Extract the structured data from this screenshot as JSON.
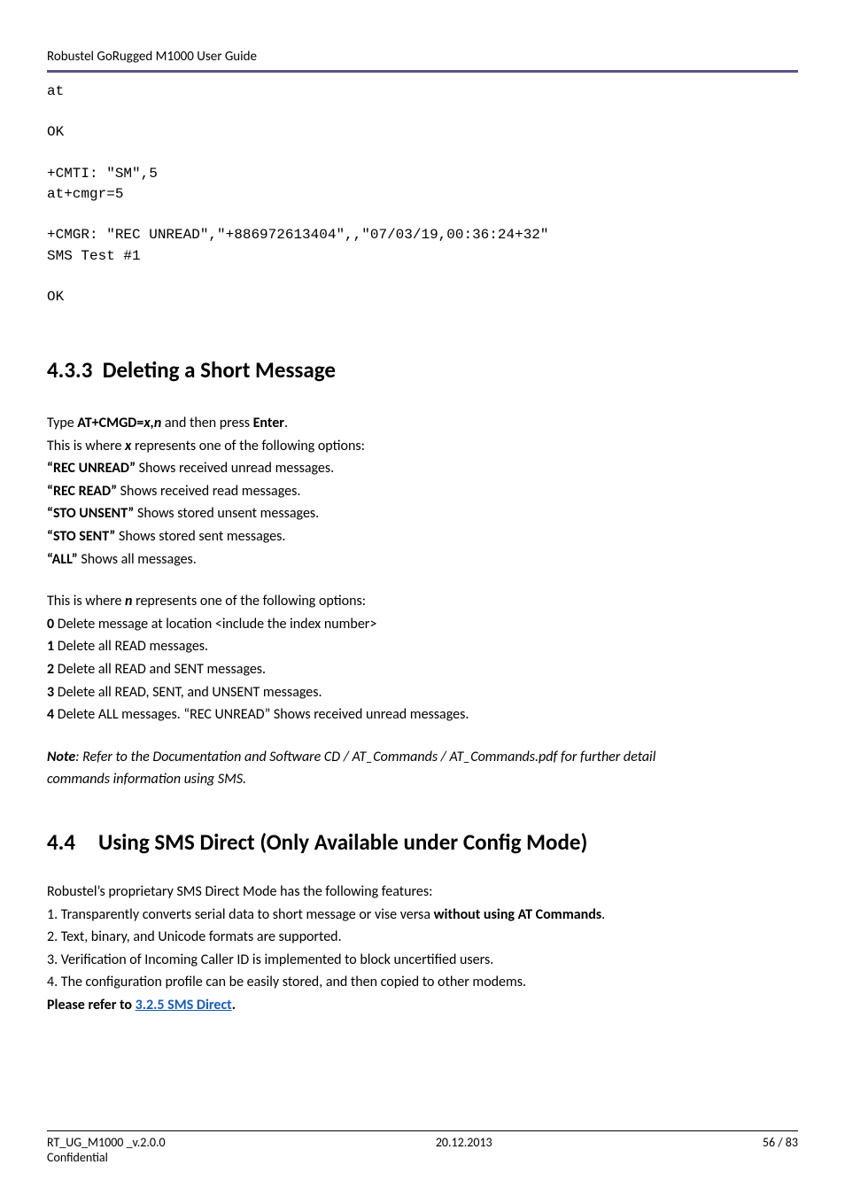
{
  "header": {
    "title": "Robustel GoRugged M1000 User Guide"
  },
  "terminal": {
    "text": "at\n\nOK\n\n+CMTI: \"SM\",5\nat+cmgr=5\n\n+CMGR: \"REC UNREAD\",\"+886972613404\",,\"07/03/19,00:36:24+32\"\nSMS Test #1\n\nOK"
  },
  "section_433": {
    "number": "4.3.3",
    "title": "Deleting a Short Message",
    "type_prefix": "Type ",
    "cmd": "AT+CMGD=",
    "cmd_var": "x,n",
    "type_suffix": " and then press ",
    "enter": "Enter",
    "period": ".",
    "x_intro_a": "This is where ",
    "x_intro_b": "x",
    "x_intro_c": " represents one of the following options:",
    "x_opts": [
      {
        "k": "“REC UNREAD”",
        "v": " Shows received unread messages."
      },
      {
        "k": "“REC READ”",
        "v": " Shows received read messages."
      },
      {
        "k": "“STO UNSENT”",
        "v": " Shows stored unsent messages."
      },
      {
        "k": "“STO SENT”",
        "v": " Shows stored sent messages."
      },
      {
        "k": "“ALL”",
        "v": " Shows all messages."
      }
    ],
    "n_intro_a": "This is where ",
    "n_intro_b": "n",
    "n_intro_c": " represents one of the following options:",
    "n_opts": [
      {
        "k": "0",
        "v": " Delete message at location <include the index number>"
      },
      {
        "k": "1",
        "v": " Delete all READ messages."
      },
      {
        "k": "2",
        "v": " Delete all READ and SENT messages."
      },
      {
        "k": "3",
        "v": " Delete all READ, SENT, and UNSENT messages."
      },
      {
        "k": "4",
        "v": " Delete ALL messages. “REC UNREAD” Shows received unread messages."
      }
    ],
    "note_label": "Note",
    "note_line1": ": Refer to the Documentation and Software CD / AT_Commands / AT_Commands.pdf for further detail",
    "note_line2": "commands information using SMS."
  },
  "section_44": {
    "number": "4.4",
    "title": "Using SMS Direct (Only Available under Config Mode)",
    "intro": "Robustel’s proprietary SMS Direct Mode has the following features:",
    "f1_a": "1. Transparently converts serial data to short message or vise versa ",
    "f1_b": "without using AT Commands",
    "f1_c": ".",
    "f2": "2. Text, binary, and Unicode formats are supported.",
    "f3": "3. Verification of Incoming Caller ID is implemented to block uncertified users.",
    "f4": "4. The configuration profile can be easily stored, and then copied to other modems.",
    "refer_a": "Please refer to ",
    "refer_link": "3.2.5 SMS Direct",
    "refer_c": "."
  },
  "footer": {
    "left": "RT_UG_M1000 _v.2.0.0",
    "center": "20.12.2013",
    "right": "56 / 83",
    "conf": "Confidential"
  }
}
